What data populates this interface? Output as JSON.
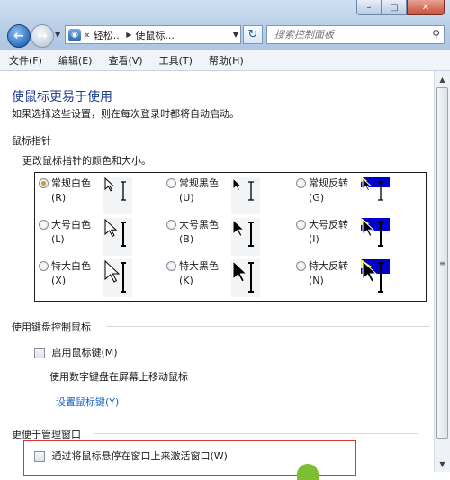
{
  "window": {
    "controls": {
      "minimize": "–",
      "maximize": "□",
      "close": "✕"
    }
  },
  "nav": {
    "back_glyph": "←",
    "breadcrumb": [
      "«",
      "轻松...",
      "使鼠标..."
    ],
    "search_placeholder": "搜索控制面板"
  },
  "menu": [
    "文件(F)",
    "编辑(E)",
    "查看(V)",
    "工具(T)",
    "帮助(H)"
  ],
  "page": {
    "title": "使鼠标更易于使用",
    "subtitle": "如果选择这些设置，则在每次登录时都将自动启动。"
  },
  "pointers": {
    "section_title": "鼠标指针",
    "description": "更改鼠标指针的颜色和大小。",
    "options": [
      {
        "label": "常规白色",
        "key": "(R)",
        "checked": true,
        "style": "white",
        "size": 1
      },
      {
        "label": "常规黑色",
        "key": "(U)",
        "checked": false,
        "style": "black",
        "size": 1
      },
      {
        "label": "常规反转",
        "key": "(G)",
        "checked": false,
        "style": "invert",
        "size": 1
      },
      {
        "label": "大号白色",
        "key": "(L)",
        "checked": false,
        "style": "white",
        "size": 2
      },
      {
        "label": "大号黑色",
        "key": "(B)",
        "checked": false,
        "style": "black",
        "size": 2
      },
      {
        "label": "大号反转",
        "key": "(I)",
        "checked": false,
        "style": "invert",
        "size": 2
      },
      {
        "label": "特大白色",
        "key": "(X)",
        "checked": false,
        "style": "white",
        "size": 3
      },
      {
        "label": "特大黑色",
        "key": "(K)",
        "checked": false,
        "style": "black",
        "size": 3
      },
      {
        "label": "特大反转",
        "key": "(N)",
        "checked": false,
        "style": "invert",
        "size": 3
      }
    ]
  },
  "keyboard": {
    "section_title": "使用键盘控制鼠标",
    "checkbox_label": "启用鼠标键(M)",
    "description": "使用数字键盘在屏幕上移动鼠标",
    "link": "设置鼠标键(Y)"
  },
  "windows": {
    "section_title": "更便于管理窗口",
    "checkbox_label": "通过将鼠标悬停在窗口上来激活窗口(W)"
  },
  "colors": {
    "title": "#1e3e8f",
    "link": "#1c63c4",
    "highlight_border": "#d93a2f",
    "invert_blue": "#0000cc",
    "invert_yellow": "#ffff00"
  }
}
